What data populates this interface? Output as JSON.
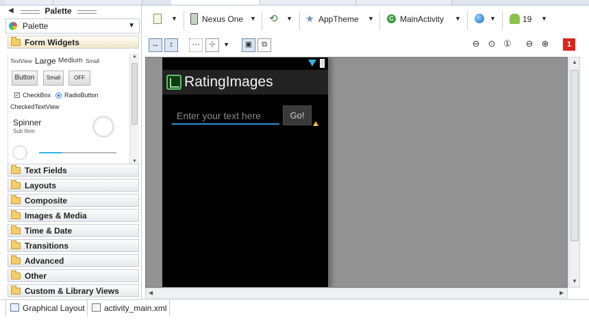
{
  "palette": {
    "title": "Palette",
    "selector": "Palette",
    "categories": [
      "Form Widgets",
      "Text Fields",
      "Layouts",
      "Composite",
      "Images & Media",
      "Time & Date",
      "Transitions",
      "Advanced",
      "Other",
      "Custom & Library Views"
    ],
    "form_widgets": {
      "textview_small": "TextView",
      "large": "Large",
      "medium": "Medium",
      "small": "Small",
      "button": "Button",
      "small_button": "Small",
      "toggle": "OFF",
      "checkbox": "CheckBox",
      "radio": "RadioButton",
      "checked_textview": "CheckedTextView",
      "spinner": "Spinner",
      "spinner_sub": "Sub Item"
    }
  },
  "toolbar": {
    "device": "Nexus One",
    "theme": "AppTheme",
    "activity": "MainActivity",
    "api_level": "19",
    "error_count": "1"
  },
  "device_preview": {
    "app_title": "RatingImages",
    "edit_hint": "Enter your text here",
    "go_button": "Go!"
  },
  "bottom_tabs": {
    "graphical": "Graphical Layout",
    "xml": "activity_main.xml"
  },
  "icons": [
    "palette-icon",
    "folder-icon",
    "phone-icon",
    "rotate-icon",
    "theme-star-icon",
    "activity-icon",
    "globe-icon",
    "android-icon",
    "zoom-icon",
    "error-icon",
    "wifi-icon",
    "battery-icon",
    "app-icon",
    "warning-icon"
  ]
}
